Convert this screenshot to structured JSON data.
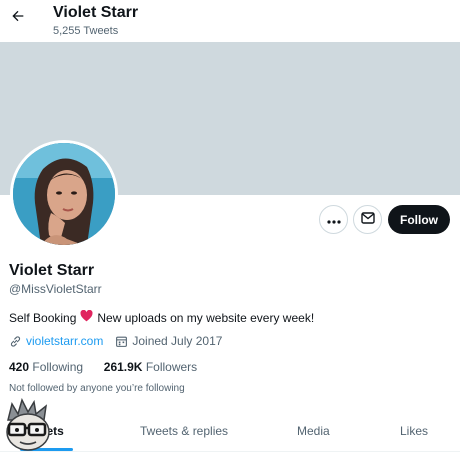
{
  "header": {
    "title": "Violet Starr",
    "tweet_count": "5,255 Tweets"
  },
  "profile": {
    "name": "Violet Starr",
    "handle": "@MissVioletStarr",
    "bio_before": "Self Booking",
    "bio_after": "New uploads on my website every week!",
    "website": "violetstarr.com",
    "joined": "Joined July 2017",
    "following_count": "420",
    "following_label": "Following",
    "followers_count": "261.9K",
    "followers_label": "Followers",
    "not_followed": "Not followed by anyone you’re following"
  },
  "actions": {
    "follow_label": "Follow"
  },
  "tabs": [
    {
      "label": "Tweets"
    },
    {
      "label": "Tweets & replies"
    },
    {
      "label": "Media"
    },
    {
      "label": "Likes"
    }
  ],
  "colors": {
    "accent": "#1d9bf0",
    "banner": "#cfd9de",
    "follow_button": "#0f1419",
    "heart": "#e0245e"
  },
  "icons": {
    "back": "arrow-left-icon",
    "more": "more-icon",
    "message": "mail-icon",
    "link": "link-icon",
    "calendar": "calendar-icon",
    "heart": "heart-icon"
  }
}
